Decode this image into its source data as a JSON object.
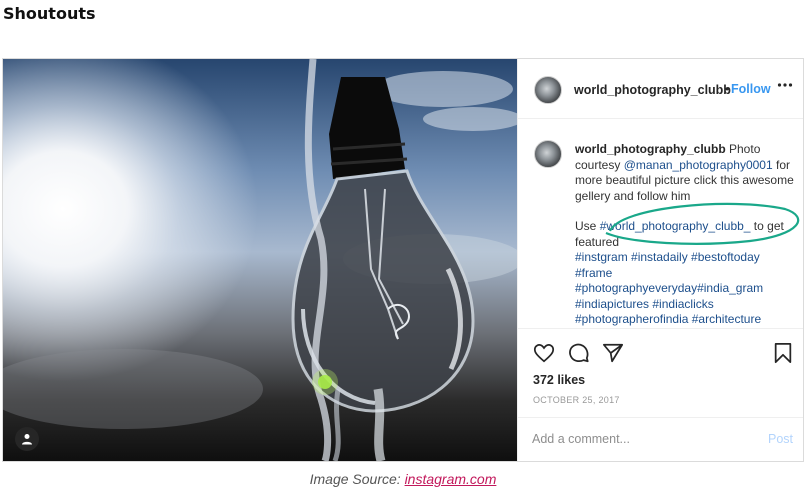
{
  "page": {
    "heading": "Shoutouts"
  },
  "post": {
    "username": "world_photography_clubb",
    "follow_separator": "•",
    "follow_label": "Follow",
    "more_icon": "more-options-icon",
    "caption": {
      "username": "world_photography_clubb",
      "text_before_mention": " Photo courtesy ",
      "mention": "@manan_photography0001",
      "text_after_mention": " for more beautiful picture click this awesome gellery and follow him",
      "use_prefix": "Use ",
      "use_tag": "#world_photography_clubb_",
      "use_suffix": " to get featured",
      "hashtag_lines": [
        "#instgram #instadaily #bestoftoday",
        "#frame",
        "#photographyeveryday#india_gram",
        "#indiapictures #indiaclicks",
        "#photographerofindia #architecture"
      ]
    },
    "highlight_color": "#1aa88a",
    "actions": {
      "like": "heart-icon",
      "comment": "comment-icon",
      "share": "share-icon",
      "save": "bookmark-icon"
    },
    "likes": "372 likes",
    "date": "OCTOBER 25, 2017",
    "comment_placeholder": "Add a comment...",
    "post_label": "Post"
  },
  "footer": {
    "source_prefix": "Image Source: ",
    "source_link": "instagram.com"
  },
  "colors": {
    "link_blue": "#3897f0",
    "source_link": "#c2185b"
  }
}
